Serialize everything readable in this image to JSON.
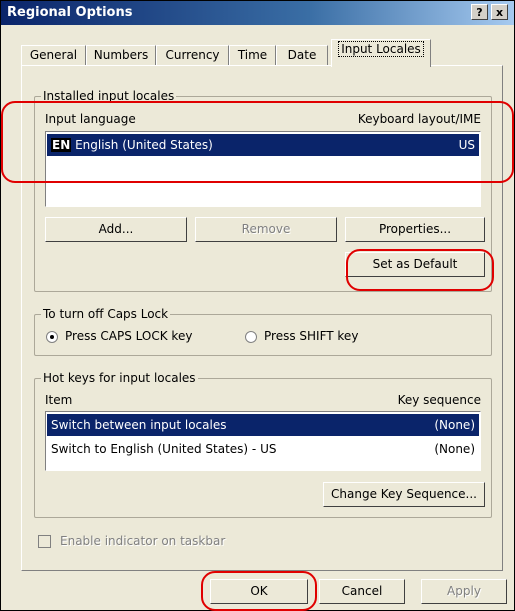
{
  "window": {
    "title": "Regional Options",
    "help_label": "?",
    "close_label": "x"
  },
  "tabs": [
    "General",
    "Numbers",
    "Currency",
    "Time",
    "Date",
    "Input Locales"
  ],
  "installed": {
    "group_label": "Installed input locales",
    "col_language": "Input language",
    "col_layout": "Keyboard layout/IME",
    "rows": [
      {
        "badge": "EN",
        "language": "English (United States)",
        "layout": "US"
      }
    ],
    "add_label": "Add...",
    "remove_label": "Remove",
    "properties_label": "Properties...",
    "set_default_label": "Set as Default"
  },
  "caps": {
    "group_label": "To turn off Caps Lock",
    "opt_caps": "Press CAPS LOCK key",
    "opt_shift": "Press SHIFT key"
  },
  "hotkeys": {
    "group_label": "Hot keys for input locales",
    "col_item": "Item",
    "col_seq": "Key sequence",
    "rows": [
      {
        "item": "Switch between input locales",
        "seq": "(None)"
      },
      {
        "item": "Switch to English (United States) - US",
        "seq": "(None)"
      }
    ],
    "change_label": "Change Key Sequence..."
  },
  "indicator_label": "Enable indicator on taskbar",
  "footer": {
    "ok_label": "OK",
    "cancel_label": "Cancel",
    "apply_label": "Apply"
  },
  "colors": {
    "selection": "#0a246a",
    "highlight": "#e00000",
    "face": "#ece9d8"
  }
}
